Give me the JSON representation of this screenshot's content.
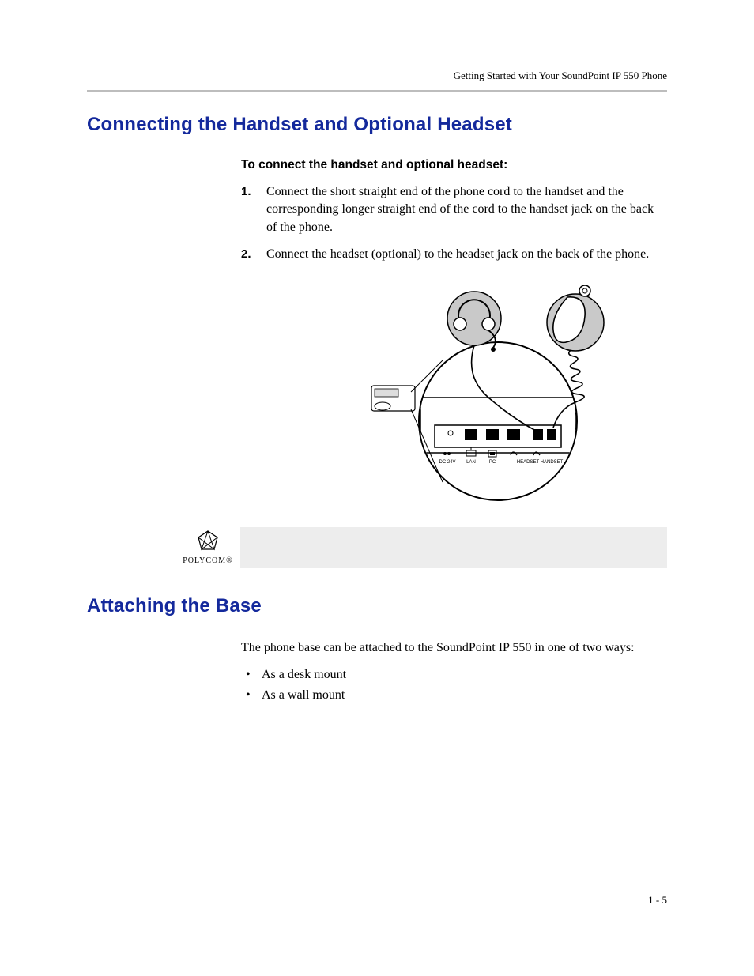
{
  "header": {
    "running_head": "Getting Started with Your SoundPoint IP 550 Phone"
  },
  "section1": {
    "title": "Connecting the Handset and Optional Headset",
    "subhead": "To connect the handset and optional headset:",
    "steps": [
      "Connect the short straight end of the phone cord to the handset and the corresponding longer straight end of the cord to the handset jack on the back of the phone.",
      "Connect the headset (optional) to the headset jack on the back of the phone."
    ],
    "port_labels": {
      "dc": "DC 24V",
      "lan": "LAN",
      "pc": "PC",
      "headset": "HEADSET",
      "handset": "HANDSET"
    }
  },
  "logo": {
    "brand": "POLYCOM",
    "suffix": "®"
  },
  "section2": {
    "title": "Attaching the Base",
    "intro": "The phone base can be attached to the SoundPoint IP 550 in one of two ways:",
    "bullets": [
      "As a desk mount",
      "As a wall mount"
    ]
  },
  "footer": {
    "page": "1 - 5"
  }
}
